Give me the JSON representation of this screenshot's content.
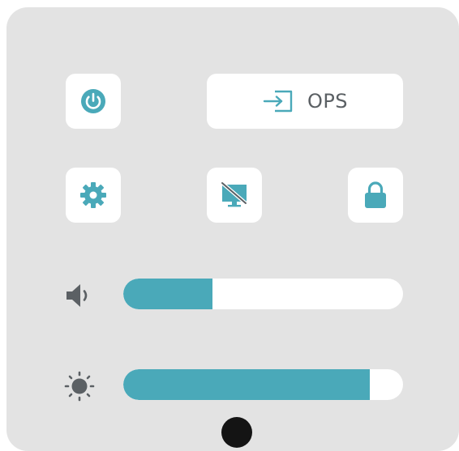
{
  "panel": {
    "ops_button": {
      "label": "OPS"
    },
    "icons": {
      "power": "power-icon",
      "ops": "input-source-icon",
      "settings": "gear-icon",
      "screen": "screen-off-icon",
      "lock": "lock-icon",
      "volume": "speaker-icon",
      "brightness": "sun-icon"
    },
    "sliders": {
      "volume": {
        "value_percent": 32
      },
      "brightness": {
        "value_percent": 88
      }
    }
  },
  "colors": {
    "panel_background": "#e3e3e3",
    "tile_background": "#ffffff",
    "accent": "#4aa9b9",
    "icon_gray": "#5b6064",
    "camera": "#141414"
  }
}
